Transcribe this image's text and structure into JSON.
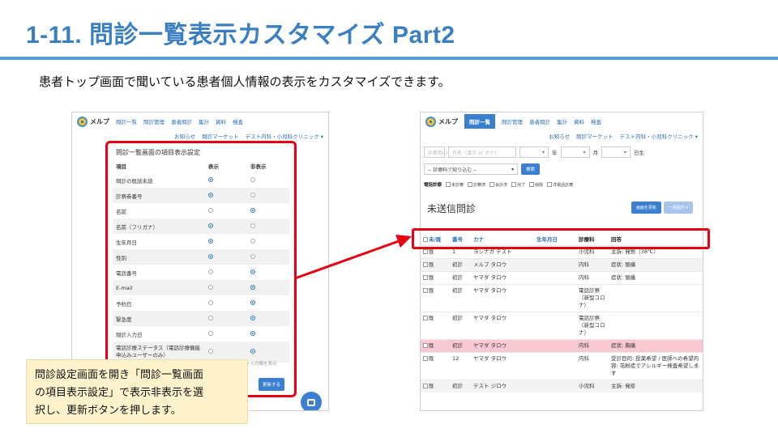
{
  "slide": {
    "title": "1-11. 問診一覧表示カスタマイズ Part2",
    "subtitle": "患者トップ画面で聞いている患者個人情報の表示をカスタマイズできます。",
    "callout": [
      "問診設定画面を開き「問診一覧画面",
      "の項目表示設定」で表示非表示を選",
      "択し、更新ボタンを押します。"
    ]
  },
  "app": {
    "logo": "メルプ",
    "nav": [
      "問診一覧",
      "問診管理",
      "患者問診",
      "集計",
      "資料",
      "検査"
    ],
    "subnav": [
      "お知らせ",
      "問診マーケット",
      "テスト内科・小児科クリニック ▾"
    ]
  },
  "settings": {
    "title": "問診一覧画面の項目表示設定",
    "headers": {
      "item": "項目",
      "show": "表示",
      "hide": "非表示"
    },
    "rows": [
      {
        "label": "問診の既読未読",
        "show": true
      },
      {
        "label": "診察券番号",
        "show": true
      },
      {
        "label": "名前",
        "show": false
      },
      {
        "label": "名前（フリガナ）",
        "show": true
      },
      {
        "label": "生年月日",
        "show": true
      },
      {
        "label": "性別",
        "show": true
      },
      {
        "label": "電話番号",
        "show": false
      },
      {
        "label": "E-mail",
        "show": false
      },
      {
        "label": "予約日",
        "show": false
      },
      {
        "label": "緊急度",
        "show": false
      },
      {
        "label": "問診入力日",
        "show": false
      },
      {
        "label": "電話診療ステータス（電話診療機能申込みユーザーのみ）",
        "show": false
      }
    ],
    "faded_note": "ヶ入力欄を表示",
    "update_label": "更新する"
  },
  "list": {
    "filters": {
      "patient_id_placeholder": "診察券ID",
      "name_placeholder": "氏名（漢字 or カナ）",
      "year_label": "年",
      "month_label": "月",
      "day_label": "日生",
      "sort_placeholder": "-- 診療科で絞り込む --",
      "search_label": "検索"
    },
    "phone_checks": {
      "label": "電話診療",
      "options": [
        "未診察",
        "診察済",
        "会計済",
        "完了",
        "削除",
        "非電話診療"
      ]
    },
    "section_title": "未送信問診",
    "head_buttons": [
      "画面を更新",
      "一括操作 ▾"
    ],
    "columns": [
      "未/既",
      "番号",
      "カナ",
      "生年月日",
      "診療科",
      "回答"
    ],
    "rows": [
      {
        "read": "既",
        "num": "1",
        "kana": "ヨシナガ テスト",
        "dept": "小児科",
        "answer": "主訴: 発熱（38℃）",
        "style": ""
      },
      {
        "read": "既",
        "num": "初診",
        "kana": "メルプ タロウ",
        "dept": "内科",
        "answer": "症状: 頭痛",
        "style": "alt"
      },
      {
        "read": "既",
        "num": "初診",
        "kana": "ヤマダ タロウ",
        "dept": "内科",
        "answer": "症状: 頭痛",
        "style": ""
      },
      {
        "read": "既",
        "num": "初診",
        "kana": "ヤマダ タロウ",
        "dept": "電話診察（新型コロナ）",
        "answer": "",
        "style": ""
      },
      {
        "read": "既",
        "num": "初診",
        "kana": "ヤマダ タロウ",
        "dept": "電話診察（新型コロナ）",
        "answer": "",
        "style": ""
      },
      {
        "read": "既",
        "num": "初診",
        "kana": "ヤマダ タロウ",
        "dept": "内科",
        "answer": "症状: 胸痛",
        "style": "pink"
      },
      {
        "read": "既",
        "num": "12",
        "kana": "ヤマダ タロウ",
        "dept": "内科",
        "answer": "受診目的: 投薬希望 / 医師への希望内容: 花粉症でアレルギー検査希望します",
        "style": ""
      },
      {
        "read": "既",
        "num": "初診",
        "kana": "テスト ジロウ",
        "dept": "小児科",
        "answer": "主訴: 発疹",
        "style": "alt"
      }
    ]
  },
  "colors": {
    "accent": "#3b7fd0",
    "highlight": "#e60012",
    "title": "#3a7fc1",
    "callout_bg": "#fdf2cb"
  }
}
